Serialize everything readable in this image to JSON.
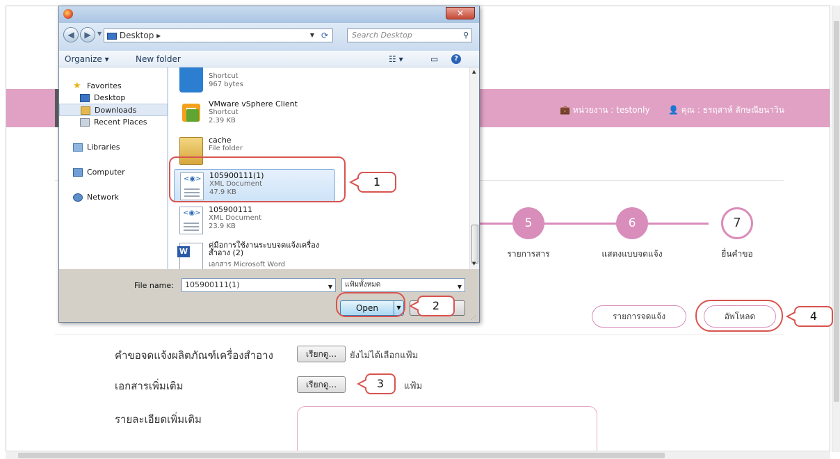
{
  "header": {
    "unit_text": "หน่วยงาน : testonly",
    "user_text": "คุณ : ธรฤสาห์ ลักษณียนาวิน"
  },
  "steps": [
    {
      "number": "5",
      "label": "รายการสาร"
    },
    {
      "number": "6",
      "label": "แสดงแบบจดแจ้ง"
    },
    {
      "number": "7",
      "label": "ยื่นคำขอ"
    }
  ],
  "actions": {
    "list_button": "รายการจดแจ้ง",
    "upload_button": "อัพโหลด"
  },
  "form": {
    "field1_label": "คำขอจดแจ้งผลิตภัณฑ์เครื่องสำอาง",
    "field1_browse": "เรียกดู...",
    "field1_status": "ยังไม่ได้เลือกแฟ้ม",
    "field2_label": "เอกสารเพิ่มเติม",
    "field2_browse": "เรียกดู...",
    "field2_status_tail": "แฟ้ม",
    "field3_label": "รายละเอียดเพิ่มเติม"
  },
  "dialog": {
    "address": "Desktop",
    "search_placeholder": "Search Desktop",
    "organize": "Organize",
    "new_folder": "New folder",
    "nav": {
      "favorites": "Favorites",
      "desktop": "Desktop",
      "downloads": "Downloads",
      "recent_places": "Recent Places",
      "libraries": "Libraries",
      "computer": "Computer",
      "network": "Network"
    },
    "files": [
      {
        "name": "",
        "type": "Shortcut",
        "size": "967 bytes"
      },
      {
        "name": "VMware vSphere Client",
        "type": "Shortcut",
        "size": "2.39 KB"
      },
      {
        "name": "cache",
        "type": "File folder",
        "size": ""
      },
      {
        "name": "105900111(1)",
        "type": "XML Document",
        "size": "47.9 KB"
      },
      {
        "name": "105900111",
        "type": "XML Document",
        "size": "23.9 KB"
      },
      {
        "name": "คู่มือการใช้งานระบบจดแจ้งเครื่องสำอาง (2)",
        "type": "เอกสาร Microsoft Word",
        "size": ""
      }
    ],
    "file_name_label": "File name:",
    "file_name_value": "105900111(1)",
    "file_type": "แฟ้มทั้งหมด",
    "open_button": "Open"
  },
  "callouts": [
    "1",
    "2",
    "3",
    "4"
  ],
  "colors": {
    "accent_pink": "#e0a1c4",
    "step_pink": "#d98dbb",
    "callout_red": "#d9534f"
  }
}
